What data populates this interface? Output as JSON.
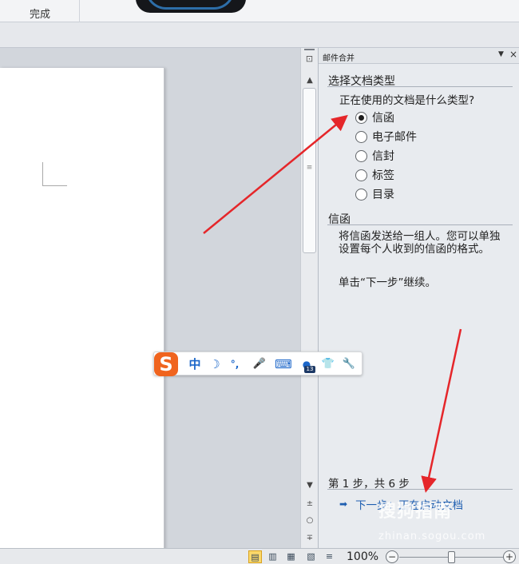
{
  "ribbon": {
    "group_label": "完成"
  },
  "scrollbar": {
    "ruler_glyph": "⊡",
    "up_glyph": "▲",
    "down_glyph": "▼",
    "grip_glyph": "≡",
    "prev_glyph": "±",
    "select_glyph": "○",
    "next_glyph": "∓"
  },
  "task_pane": {
    "title": "邮件合并",
    "menu_glyph": "▼",
    "close_glyph": "×",
    "section_doc_type": "选择文档类型",
    "question": "正在使用的文档是什么类型?",
    "options": [
      {
        "label": "信函",
        "selected": true
      },
      {
        "label": "电子邮件",
        "selected": false
      },
      {
        "label": "信封",
        "selected": false
      },
      {
        "label": "标签",
        "selected": false
      },
      {
        "label": "目录",
        "selected": false
      }
    ],
    "section_letter": "信函",
    "description": "将信函发送给一组人。您可以单独设置每个人收到的信函的格式。",
    "continue_hint": "单击“下一步”继续。",
    "step_info": "第 1 步，共 6 步",
    "next_arrow": "➡",
    "next_link": "下一步：正在启动文档"
  },
  "ime_toolbar": {
    "logo": "S",
    "lang": "中",
    "moon": "☽",
    "punct": "°,",
    "mic": "🎤",
    "keyboard": "⌨",
    "badge": "13",
    "shirt": "👕",
    "wrench": "🔧"
  },
  "watermark": {
    "text": "搜狗指南",
    "url": "zhinan.sogou.com"
  },
  "statusbar": {
    "zoom": "100%",
    "zoom_minus": "−",
    "zoom_plus": "+",
    "views": [
      "▤",
      "▥",
      "▦",
      "▧",
      "≡"
    ]
  },
  "colors": {
    "arrow": "#e5262a",
    "link": "#1f5fb1",
    "ime_logo": "#f0641e",
    "active_view": "#fbd86a"
  }
}
